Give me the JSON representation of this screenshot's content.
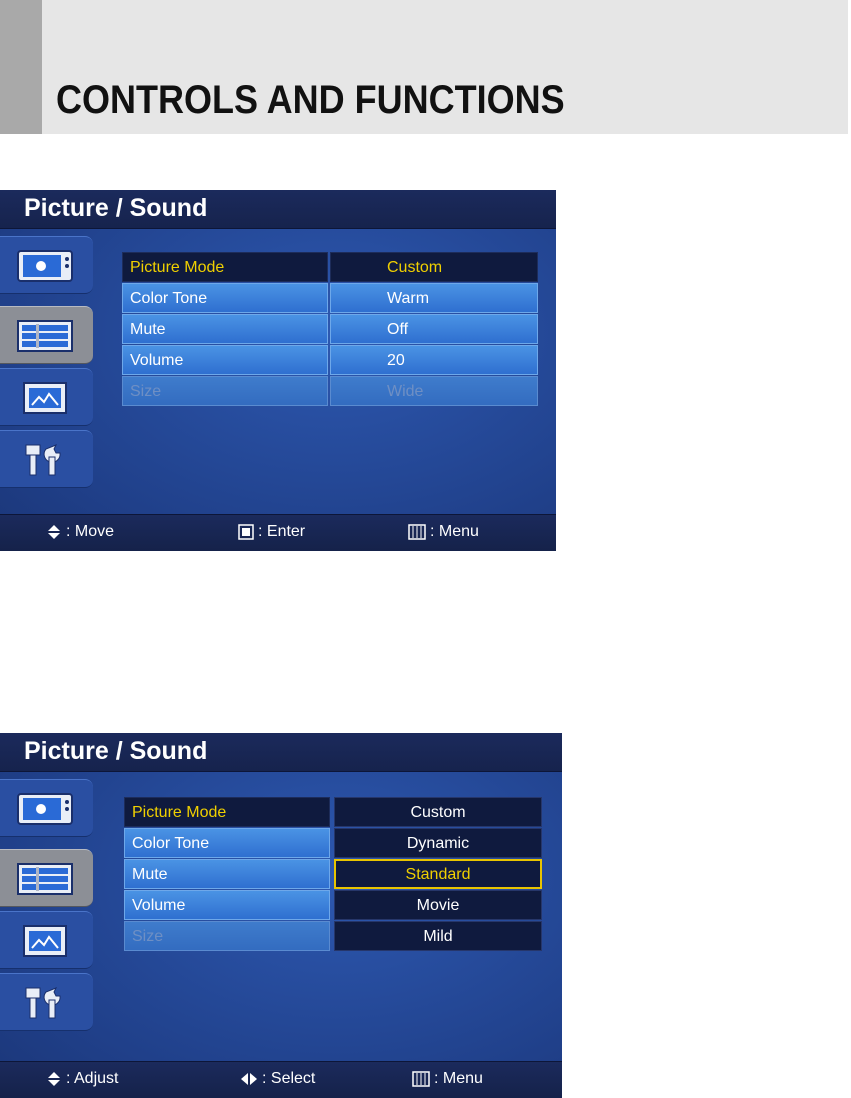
{
  "header": {
    "title": "CONTROLS AND FUNCTIONS"
  },
  "osd1": {
    "title": "Picture / Sound",
    "rows": [
      {
        "label": "Picture Mode",
        "value": "Custom"
      },
      {
        "label": "Color Tone",
        "value": "Warm"
      },
      {
        "label": "Mute",
        "value": "Off"
      },
      {
        "label": "Volume",
        "value": "20"
      },
      {
        "label": "Size",
        "value": "Wide"
      }
    ],
    "footer": {
      "move": ": Move",
      "enter": ": Enter",
      "menu": ": Menu"
    }
  },
  "osd2": {
    "title": "Picture / Sound",
    "rows": [
      {
        "label": "Picture Mode",
        "value": "Custom"
      },
      {
        "label": "Color Tone",
        "value": "Dynamic"
      },
      {
        "label": "Mute",
        "value": "Standard"
      },
      {
        "label": "Volume",
        "value": "Movie"
      },
      {
        "label": "Size",
        "value": "Mild"
      }
    ],
    "footer": {
      "adjust": ": Adjust",
      "select": ": Select",
      "menu": ": Menu"
    }
  },
  "colors": {
    "highlight": "#f0d000",
    "menu_blue": "#2f6fd0",
    "panel_dark": "#0f1a3e"
  }
}
